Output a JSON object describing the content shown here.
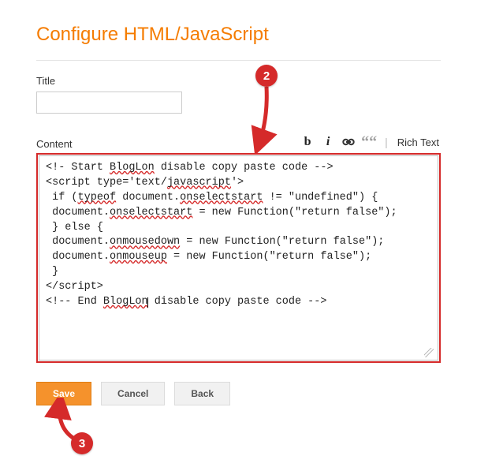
{
  "header": {
    "title": "Configure HTML/JavaScript"
  },
  "title": {
    "label": "Title",
    "value": ""
  },
  "content": {
    "label": "Content",
    "toolbar": {
      "bold_glyph": "b",
      "italic_glyph": "i",
      "quote_glyph": "““",
      "richtext_label": "Rich Text"
    },
    "code_segments": [
      {
        "t": "<!- Start "
      },
      {
        "t": "BlogLon",
        "err": true
      },
      {
        "t": " disable copy paste code -->\n<script type='text/"
      },
      {
        "t": "javascript",
        "err": true
      },
      {
        "t": "'>\n if ("
      },
      {
        "t": "typeof",
        "err": true
      },
      {
        "t": " document."
      },
      {
        "t": "onselectstart",
        "err": true
      },
      {
        "t": " != \"undefined\") {\n document."
      },
      {
        "t": "onselectstart",
        "err": true
      },
      {
        "t": " = new Function(\"return false\");\n } else {\n document."
      },
      {
        "t": "onmousedown",
        "err": true
      },
      {
        "t": " = new Function(\"return false\");\n document."
      },
      {
        "t": "onmouseup",
        "err": true
      },
      {
        "t": " = new Function(\"return false\");\n }\n</script>\n<!-- End "
      },
      {
        "t": "BlogLon",
        "err": true
      },
      {
        "t": "",
        "caret": true
      },
      {
        "t": " disable copy paste code -->"
      }
    ]
  },
  "buttons": {
    "save": "Save",
    "cancel": "Cancel",
    "back": "Back"
  },
  "annotations": {
    "badge2": "2",
    "badge3": "3"
  }
}
